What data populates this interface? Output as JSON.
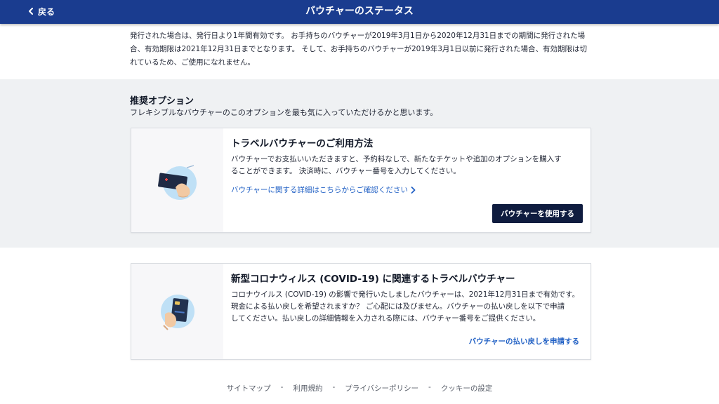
{
  "header": {
    "back_label": "戻る",
    "title": "バウチャーのステータス"
  },
  "intro": {
    "line1": "発行された場合は、発行日より1年間有効です。 お手持ちのバウチャーが2019年3月1日から2020年12月31日までの期間に発行された場",
    "line2": "合、有効期限は2021年12月31日までとなります。 そして、お手持ちのバウチャーが2019年3月1日以前に発行された場合、有効期限は切",
    "line3": "れているため、ご使用になれません。"
  },
  "recommended": {
    "title": "推奨オプション",
    "subtitle": "フレキシブルなバウチャーのこのオプションを最も気に入っていただけるかと思います。"
  },
  "card_travel": {
    "title": "トラベルバウチャーのご利用方法",
    "body_line1": "バウチャーでお支払いいただきますと、予約料なしで、新たなチケットや追加のオプションを購入す",
    "body_line2": "ることができます。 決済時に、バウチャー番号を入力してください。",
    "link": "バウチャーに関する詳細はこちらからご確認ください",
    "button": "バウチャーを使用する"
  },
  "card_covid": {
    "title": "新型コロナウィルス (COVID-19) に関連するトラベルバウチャー",
    "body_line1": "コロナウイルス (COVID-19) の影響で発行いたしましたバウチャーは、2021年12月31日まで有効です。",
    "body_line2": "現金による払い戻しを希望されますか？ ご心配には及びません。バウチャーの払い戻しを以下で申請",
    "body_line3": "してください。払い戻しの詳細情報を入力される際には、バウチャー番号をご提供ください。",
    "link": "バウチャーの払い戻しを申請する"
  },
  "footer": {
    "items": [
      "サイトマップ",
      "利用規約",
      "プライバシーポリシー",
      "クッキーの設定"
    ],
    "separator": "-"
  },
  "colors": {
    "header_bg": "#1a3c8f",
    "band_bg": "#eff1f3",
    "primary_button": "#0f1c3f",
    "link": "#1f5fc4"
  },
  "icons": [
    "chevron-left-icon",
    "chevron-right-icon",
    "boarding-pass-hand-icon",
    "card-hand-icon"
  ]
}
